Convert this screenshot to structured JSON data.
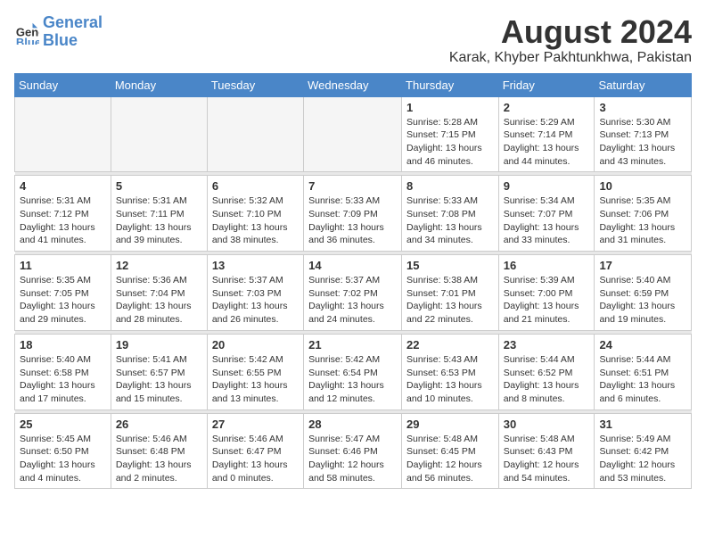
{
  "header": {
    "logo_line1": "General",
    "logo_line2": "Blue",
    "month_year": "August 2024",
    "location": "Karak, Khyber Pakhtunkhwa, Pakistan"
  },
  "weekdays": [
    "Sunday",
    "Monday",
    "Tuesday",
    "Wednesday",
    "Thursday",
    "Friday",
    "Saturday"
  ],
  "weeks": [
    [
      {
        "day": "",
        "info": ""
      },
      {
        "day": "",
        "info": ""
      },
      {
        "day": "",
        "info": ""
      },
      {
        "day": "",
        "info": ""
      },
      {
        "day": "1",
        "info": "Sunrise: 5:28 AM\nSunset: 7:15 PM\nDaylight: 13 hours\nand 46 minutes."
      },
      {
        "day": "2",
        "info": "Sunrise: 5:29 AM\nSunset: 7:14 PM\nDaylight: 13 hours\nand 44 minutes."
      },
      {
        "day": "3",
        "info": "Sunrise: 5:30 AM\nSunset: 7:13 PM\nDaylight: 13 hours\nand 43 minutes."
      }
    ],
    [
      {
        "day": "4",
        "info": "Sunrise: 5:31 AM\nSunset: 7:12 PM\nDaylight: 13 hours\nand 41 minutes."
      },
      {
        "day": "5",
        "info": "Sunrise: 5:31 AM\nSunset: 7:11 PM\nDaylight: 13 hours\nand 39 minutes."
      },
      {
        "day": "6",
        "info": "Sunrise: 5:32 AM\nSunset: 7:10 PM\nDaylight: 13 hours\nand 38 minutes."
      },
      {
        "day": "7",
        "info": "Sunrise: 5:33 AM\nSunset: 7:09 PM\nDaylight: 13 hours\nand 36 minutes."
      },
      {
        "day": "8",
        "info": "Sunrise: 5:33 AM\nSunset: 7:08 PM\nDaylight: 13 hours\nand 34 minutes."
      },
      {
        "day": "9",
        "info": "Sunrise: 5:34 AM\nSunset: 7:07 PM\nDaylight: 13 hours\nand 33 minutes."
      },
      {
        "day": "10",
        "info": "Sunrise: 5:35 AM\nSunset: 7:06 PM\nDaylight: 13 hours\nand 31 minutes."
      }
    ],
    [
      {
        "day": "11",
        "info": "Sunrise: 5:35 AM\nSunset: 7:05 PM\nDaylight: 13 hours\nand 29 minutes."
      },
      {
        "day": "12",
        "info": "Sunrise: 5:36 AM\nSunset: 7:04 PM\nDaylight: 13 hours\nand 28 minutes."
      },
      {
        "day": "13",
        "info": "Sunrise: 5:37 AM\nSunset: 7:03 PM\nDaylight: 13 hours\nand 26 minutes."
      },
      {
        "day": "14",
        "info": "Sunrise: 5:37 AM\nSunset: 7:02 PM\nDaylight: 13 hours\nand 24 minutes."
      },
      {
        "day": "15",
        "info": "Sunrise: 5:38 AM\nSunset: 7:01 PM\nDaylight: 13 hours\nand 22 minutes."
      },
      {
        "day": "16",
        "info": "Sunrise: 5:39 AM\nSunset: 7:00 PM\nDaylight: 13 hours\nand 21 minutes."
      },
      {
        "day": "17",
        "info": "Sunrise: 5:40 AM\nSunset: 6:59 PM\nDaylight: 13 hours\nand 19 minutes."
      }
    ],
    [
      {
        "day": "18",
        "info": "Sunrise: 5:40 AM\nSunset: 6:58 PM\nDaylight: 13 hours\nand 17 minutes."
      },
      {
        "day": "19",
        "info": "Sunrise: 5:41 AM\nSunset: 6:57 PM\nDaylight: 13 hours\nand 15 minutes."
      },
      {
        "day": "20",
        "info": "Sunrise: 5:42 AM\nSunset: 6:55 PM\nDaylight: 13 hours\nand 13 minutes."
      },
      {
        "day": "21",
        "info": "Sunrise: 5:42 AM\nSunset: 6:54 PM\nDaylight: 13 hours\nand 12 minutes."
      },
      {
        "day": "22",
        "info": "Sunrise: 5:43 AM\nSunset: 6:53 PM\nDaylight: 13 hours\nand 10 minutes."
      },
      {
        "day": "23",
        "info": "Sunrise: 5:44 AM\nSunset: 6:52 PM\nDaylight: 13 hours\nand 8 minutes."
      },
      {
        "day": "24",
        "info": "Sunrise: 5:44 AM\nSunset: 6:51 PM\nDaylight: 13 hours\nand 6 minutes."
      }
    ],
    [
      {
        "day": "25",
        "info": "Sunrise: 5:45 AM\nSunset: 6:50 PM\nDaylight: 13 hours\nand 4 minutes."
      },
      {
        "day": "26",
        "info": "Sunrise: 5:46 AM\nSunset: 6:48 PM\nDaylight: 13 hours\nand 2 minutes."
      },
      {
        "day": "27",
        "info": "Sunrise: 5:46 AM\nSunset: 6:47 PM\nDaylight: 13 hours\nand 0 minutes."
      },
      {
        "day": "28",
        "info": "Sunrise: 5:47 AM\nSunset: 6:46 PM\nDaylight: 12 hours\nand 58 minutes."
      },
      {
        "day": "29",
        "info": "Sunrise: 5:48 AM\nSunset: 6:45 PM\nDaylight: 12 hours\nand 56 minutes."
      },
      {
        "day": "30",
        "info": "Sunrise: 5:48 AM\nSunset: 6:43 PM\nDaylight: 12 hours\nand 54 minutes."
      },
      {
        "day": "31",
        "info": "Sunrise: 5:49 AM\nSunset: 6:42 PM\nDaylight: 12 hours\nand 53 minutes."
      }
    ]
  ]
}
